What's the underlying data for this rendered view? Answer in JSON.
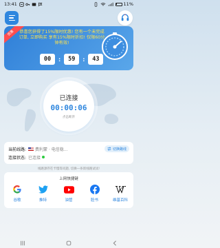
{
  "status_bar": {
    "time": "13:41",
    "battery_text": "11%",
    "battery_level": 0.11
  },
  "promo": {
    "tag": "优惠",
    "text": "恭喜您获得了15%限时优惠! 您有一个未完成订单, 立即购买 享有15%限时折扣! 仅限60分钟有效!",
    "countdown": {
      "hours": "00",
      "minutes": "59",
      "seconds": "43"
    },
    "sep": ":"
  },
  "connection": {
    "status": "已连接",
    "timer": "00:00:06",
    "hint": "点击断开"
  },
  "info": {
    "line_label": "当前线路:",
    "line_value": "费利蒙 · 电信稳...",
    "switch_label": "切换路线",
    "status_label": "连接状态:",
    "status_value": "已连接"
  },
  "tip": "线路源存在卡慢等问题, 切换一条新线路试试!",
  "quick": {
    "title": "上网快捷键",
    "items": [
      {
        "label": "谷歌",
        "icon": "google-icon"
      },
      {
        "label": "推特",
        "icon": "twitter-icon"
      },
      {
        "label": "油管",
        "icon": "youtube-icon"
      },
      {
        "label": "脸书",
        "icon": "facebook-icon"
      },
      {
        "label": "维基百科",
        "icon": "wikipedia-icon"
      }
    ]
  },
  "colors": {
    "accent": "#2e86de",
    "promo_text": "#ffe24a",
    "status_ok": "#2ecc40"
  }
}
